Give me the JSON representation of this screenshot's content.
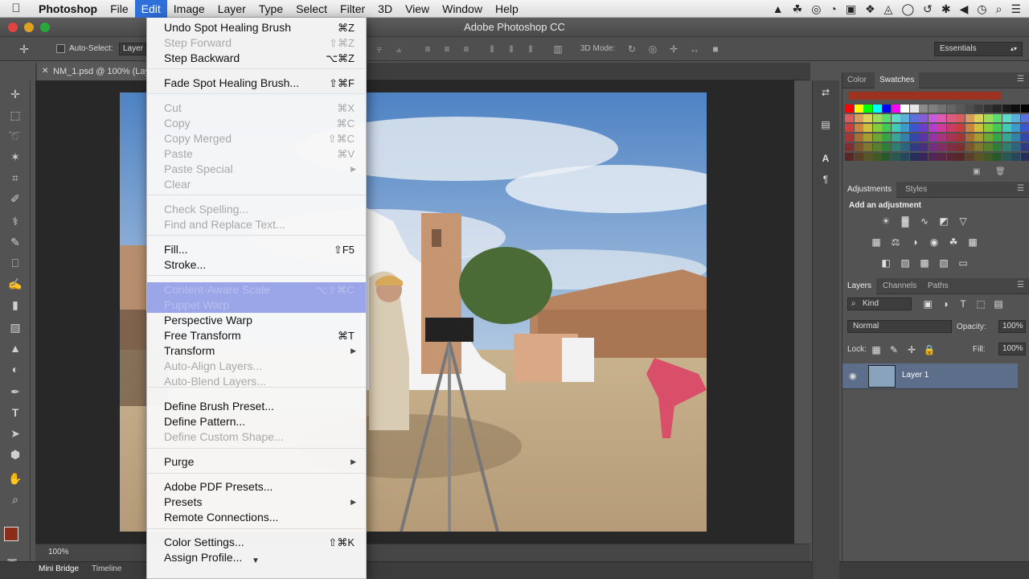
{
  "menubar": {
    "app": "Photoshop",
    "items": [
      "File",
      "Edit",
      "Image",
      "Layer",
      "Type",
      "Select",
      "Filter",
      "3D",
      "View",
      "Window",
      "Help"
    ],
    "active_index": 1
  },
  "window": {
    "title": "Adobe Photoshop CC"
  },
  "options_bar": {
    "auto_select_label": "Auto-Select:",
    "auto_select_target": "Layer",
    "mode_3d_label": "3D Mode:",
    "workspace": "Essentials"
  },
  "document": {
    "tab_title": "NM_1.psd @ 100% (Lay"
  },
  "status_bar": {
    "zoom": "100%"
  },
  "bottom_tabs": [
    "Mini Bridge",
    "Timeline"
  ],
  "edit_menu": {
    "items": [
      {
        "label": "Undo Spot Healing Brush",
        "shortcut": "⌘Z",
        "enabled": true
      },
      {
        "label": "Step Forward",
        "shortcut": "⇧⌘Z",
        "enabled": false
      },
      {
        "label": "Step Backward",
        "shortcut": "⌥⌘Z",
        "enabled": true
      },
      {
        "label": "Fade Spot Healing Brush...",
        "shortcut": "⇧⌘F",
        "enabled": true
      },
      {
        "label": "Cut",
        "shortcut": "⌘X",
        "enabled": false
      },
      {
        "label": "Copy",
        "shortcut": "⌘C",
        "enabled": false
      },
      {
        "label": "Copy Merged",
        "shortcut": "⇧⌘C",
        "enabled": false
      },
      {
        "label": "Paste",
        "shortcut": "⌘V",
        "enabled": false
      },
      {
        "label": "Paste Special",
        "shortcut": "",
        "enabled": false,
        "submenu": true
      },
      {
        "label": "Clear",
        "shortcut": "",
        "enabled": false
      },
      {
        "label": "Check Spelling...",
        "shortcut": "",
        "enabled": false
      },
      {
        "label": "Find and Replace Text...",
        "shortcut": "",
        "enabled": false
      },
      {
        "label": "Fill...",
        "shortcut": "⇧F5",
        "enabled": true
      },
      {
        "label": "Stroke...",
        "shortcut": "",
        "enabled": true
      },
      {
        "label": "Content-Aware Scale",
        "shortcut": "⌥⇧⌘C",
        "enabled": false,
        "highlighted": true
      },
      {
        "label": "Puppet Warp",
        "shortcut": "",
        "enabled": false,
        "highlighted": true
      },
      {
        "label": "Perspective Warp",
        "shortcut": "",
        "enabled": true
      },
      {
        "label": "Free Transform",
        "shortcut": "⌘T",
        "enabled": true
      },
      {
        "label": "Transform",
        "shortcut": "",
        "enabled": true,
        "submenu": true
      },
      {
        "label": "Auto-Align Layers...",
        "shortcut": "",
        "enabled": false
      },
      {
        "label": "Auto-Blend Layers...",
        "shortcut": "",
        "enabled": false
      },
      {
        "label": "Define Brush Preset...",
        "shortcut": "",
        "enabled": true
      },
      {
        "label": "Define Pattern...",
        "shortcut": "",
        "enabled": true
      },
      {
        "label": "Define Custom Shape...",
        "shortcut": "",
        "enabled": false
      },
      {
        "label": "Purge",
        "shortcut": "",
        "enabled": true,
        "submenu": true
      },
      {
        "label": "Adobe PDF Presets...",
        "shortcut": "",
        "enabled": true
      },
      {
        "label": "Presets",
        "shortcut": "",
        "enabled": true,
        "submenu": true
      },
      {
        "label": "Remote Connections...",
        "shortcut": "",
        "enabled": true
      },
      {
        "label": "Color Settings...",
        "shortcut": "⇧⌘K",
        "enabled": true
      },
      {
        "label": "Assign Profile...",
        "shortcut": "",
        "enabled": true
      }
    ]
  },
  "panels": {
    "color_tabs": [
      "Color",
      "Swatches"
    ],
    "adjust_tabs": [
      "Adjustments",
      "Styles"
    ],
    "adjust_heading": "Add an adjustment",
    "layers_tabs": [
      "Layers",
      "Channels",
      "Paths"
    ],
    "kind_filter": "Kind",
    "blend_mode": "Normal",
    "opacity_label": "Opacity:",
    "opacity_value": "100%",
    "lock_label": "Lock:",
    "fill_label": "Fill:",
    "fill_value": "100%",
    "layer_name": "Layer 1"
  },
  "colors": {
    "highlight": "#9aa6e8",
    "menu_active": "#2f6fdc",
    "foreground_swatch": "#8b2d1a"
  }
}
